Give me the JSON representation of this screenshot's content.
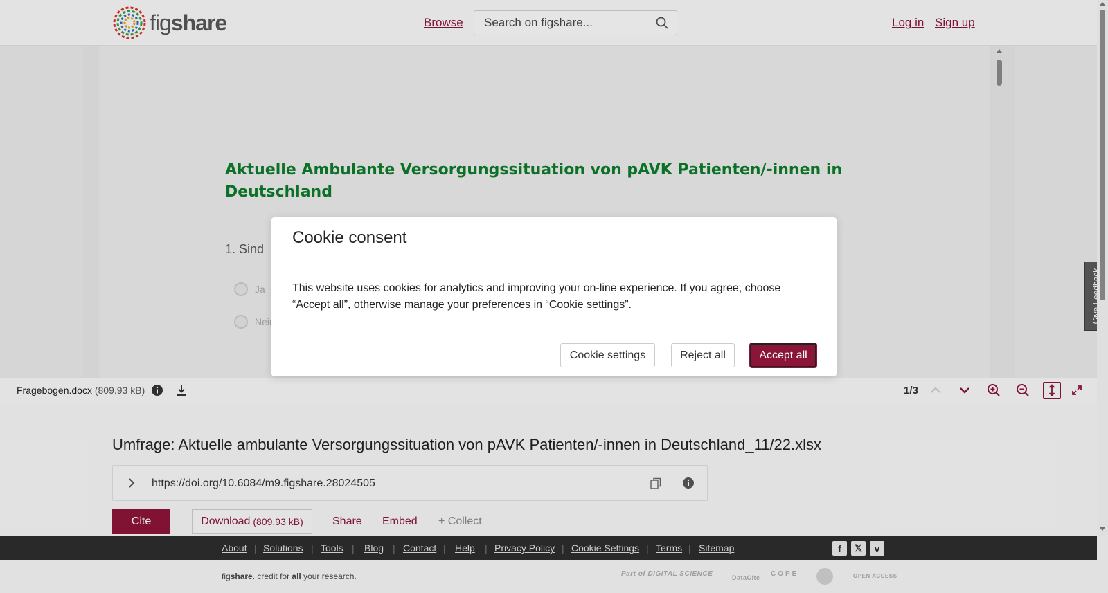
{
  "header": {
    "logo_prefix": "fig",
    "logo_suffix": "share",
    "browse": "Browse",
    "search_placeholder": "Search on figshare...",
    "login": "Log in",
    "signup": "Sign up"
  },
  "document": {
    "title": "Aktuelle Ambulante Versorgungssituation von pAVK Patienten/-innen in Deutschland",
    "question_1": "1. Sind",
    "option_1": "Ja",
    "option_2": "Nein"
  },
  "viewer_toolbar": {
    "file_name": "Fragebogen.docx",
    "file_size": "(809.93 kB)",
    "page_indicator": "1/3"
  },
  "item": {
    "title": "Umfrage: Aktuelle ambulante Versorgungssituation von pAVK Patienten/-innen in Deutschland_11/22.xlsx",
    "doi": "https://doi.org/10.6084/m9.figshare.28024505",
    "cite": "Cite",
    "download": "Download",
    "download_size": "(809.93 kB)",
    "share": "Share",
    "embed": "Embed",
    "collect": "+ Collect"
  },
  "footer": {
    "links": [
      "About",
      "Solutions",
      "Tools",
      "Blog",
      "Contact",
      "Help",
      "Privacy Policy",
      "Cookie Settings",
      "Terms",
      "Sitemap"
    ],
    "tagline_prefix": "fig",
    "tagline_brand": "share",
    "tagline_rest": ". credit for ",
    "tagline_all": "all",
    "tagline_end": " your research.",
    "partners": [
      "Part of DIGITAL SCIENCE",
      "DataCite",
      "COPE",
      "OPEN ACCESS"
    ]
  },
  "feedback": "Give Feedback",
  "cookie_modal": {
    "title": "Cookie consent",
    "body": "This website uses cookies for analytics and improving your on-line experience. If you agree, choose “Accept all”, otherwise manage your preferences in “Cookie settings”.",
    "settings": "Cookie settings",
    "reject": "Reject all",
    "accept": "Accept all"
  },
  "colors": {
    "brand": "#8a1538",
    "doc_title": "#0c7a2a",
    "footer_bg": "#2d2d2d"
  }
}
